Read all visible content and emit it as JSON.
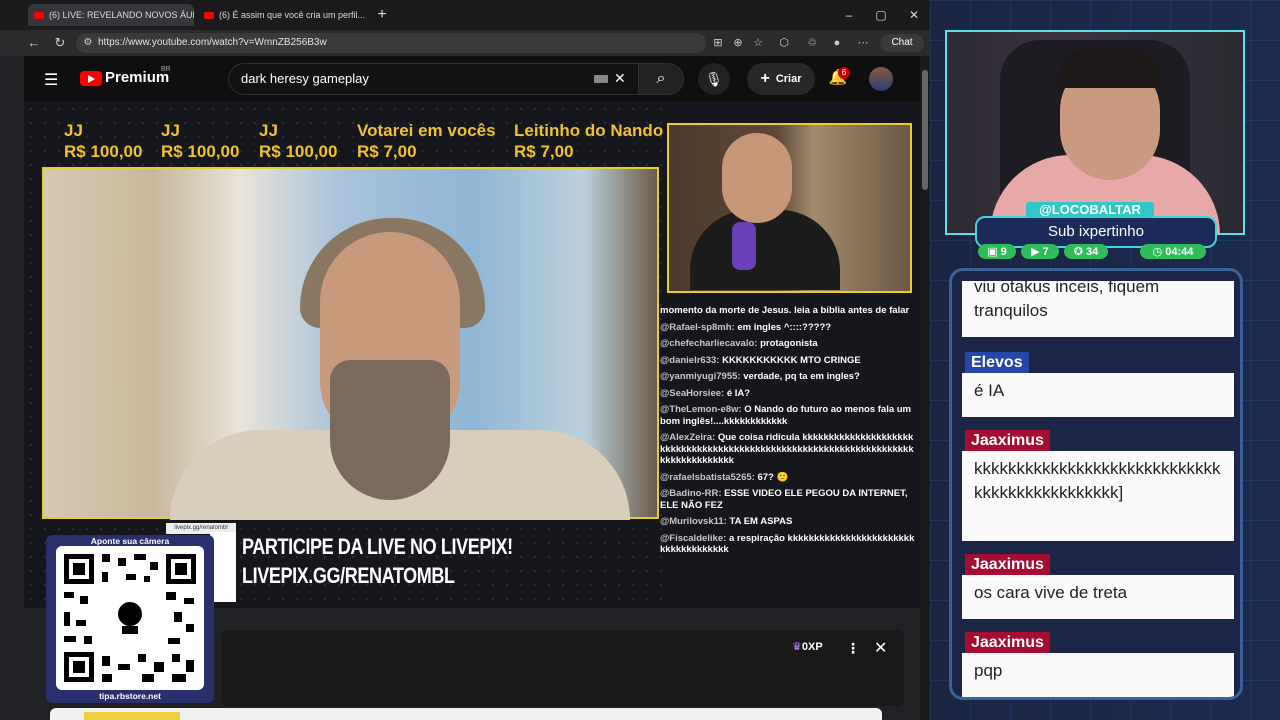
{
  "browser": {
    "tabs": [
      {
        "title": "(6) LIVE: REVELANDO NOVOS ÁUD..."
      },
      {
        "title": "(6) É assim que você cria um perfil..."
      }
    ],
    "url": "https://www.youtube.com/watch?v=WmnZB256B3w",
    "chat_label": "Chat"
  },
  "youtube": {
    "brand": "Premium",
    "region": "BR",
    "search_query": "dark heresy gameplay",
    "create_label": "Criar",
    "notification_count": "6"
  },
  "stream": {
    "donations": [
      {
        "name": "JJ",
        "amount": "R$ 100,00"
      },
      {
        "name": "JJ",
        "amount": "R$ 100,00"
      },
      {
        "name": "JJ",
        "amount": "R$ 100,00"
      },
      {
        "name": "Votarei em vocês",
        "amount": "R$ 7,00"
      },
      {
        "name": "Leitinho do Nando",
        "amount": "R$ 7,00"
      }
    ],
    "chat": [
      {
        "user": "",
        "text": "momento da morte de Jesus. leia a bíblia antes de falar"
      },
      {
        "user": "@Rafael-sp8mh:",
        "text": "em ingles ^::::?????"
      },
      {
        "user": "@chefecharliecavalo:",
        "text": "protagonista"
      },
      {
        "user": "@danielr633:",
        "text": "KKKKKKKKKKK MTO CRINGE"
      },
      {
        "user": "@yanmiyugi7955:",
        "text": "verdade, pq ta em ingles?"
      },
      {
        "user": "@SeaHorsiee:",
        "text": "é IA?"
      },
      {
        "user": "@TheLemon-e8w:",
        "text": "O Nando do futuro ao menos fala um bom inglês!....kkkkkkkkkkkk"
      },
      {
        "user": "@AlexZeira:",
        "text": "Que coisa ridícula kkkkkkkkkkkkkkkkkkkkkkkkkkkkkkkkkkkkkkkkkkkkkkkkkkkkkkkkkkkkkkkkkkkkkkkkkkkkkkkkkkk"
      },
      {
        "user": "@rafaelsbatista5265:",
        "text": "67? 🙁"
      },
      {
        "user": "@Badino-RR:",
        "text": "ESSE VIDEO ELE PEGOU DA INTERNET, ELE NÃO FEZ"
      },
      {
        "user": "@Murilovsk11:",
        "text": "TA EM ASPAS"
      },
      {
        "user": "@Fiscaldelike:",
        "text": "a respiração kkkkkkkkkkkkkkkkkkkkkkkkkkkkkkkkkkkkk"
      }
    ],
    "livepix": {
      "tooltip": "livepix.gg/renatombl",
      "qr_header": "Aponte sua câmera",
      "qr_footer": "tipa.rbstore.net",
      "line1": "PARTICIPE DA LIVE NO LIVEPIX!",
      "line2": "LIVEPIX.GG/RENATOMBL"
    }
  },
  "ytchat": {
    "xp": "0XP"
  },
  "webcam": {
    "handle": "@LOCOBALTAR",
    "sub_text": "Sub ixpertinho",
    "stats": [
      {
        "icon": "chat-icon",
        "value": "9"
      },
      {
        "icon": "youtube-icon",
        "value": "7"
      },
      {
        "icon": "gift-icon",
        "value": "34"
      },
      {
        "icon": "clock-icon",
        "value": "04:44"
      }
    ]
  },
  "sidechat": {
    "messages": [
      {
        "user": "",
        "text": "viu otakus inceis, fiquem tranquilos"
      },
      {
        "user": "Elevos",
        "text": "é IA"
      },
      {
        "user": "Jaaximus",
        "text": "kkkkkkkkkkkkkkkkkkkkkkkkkkkkkkkkkkkkkkkkkkkkkk]"
      },
      {
        "user": "Jaaximus",
        "text": "os cara vive de treta"
      },
      {
        "user": "Jaaximus",
        "text": "pqp"
      }
    ]
  }
}
